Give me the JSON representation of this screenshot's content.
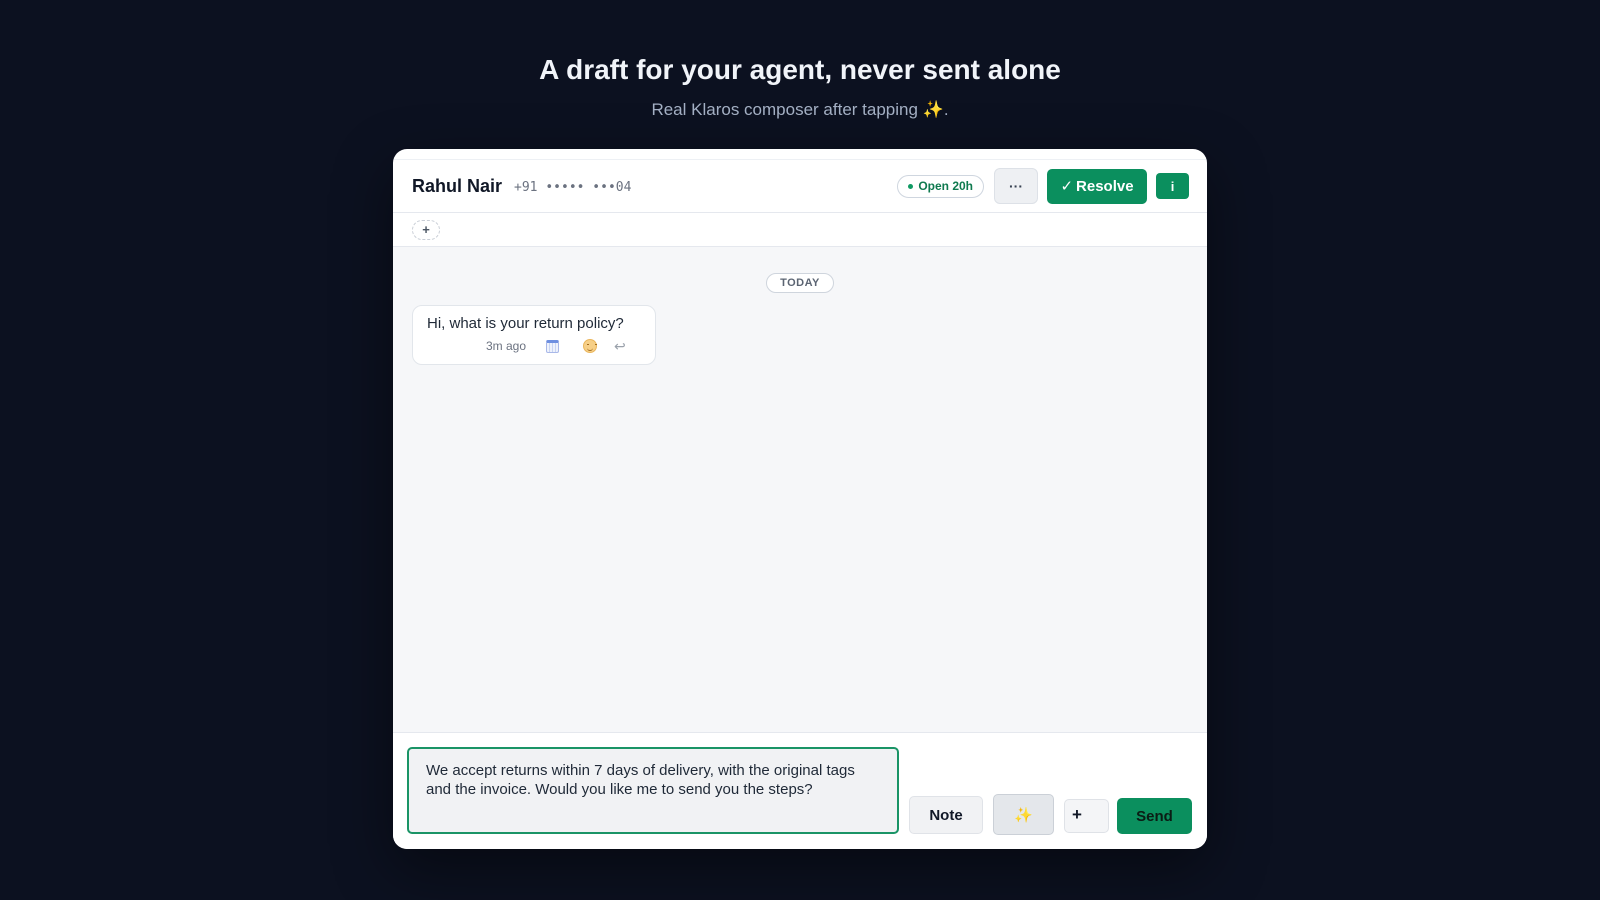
{
  "page": {
    "heading": "A draft for your agent, never sent alone",
    "subtitle": "Real Klaros composer after tapping ✨."
  },
  "header": {
    "contact_name": "Rahul Nair",
    "contact_phone": "+91 ••••• •••04",
    "status": "Open 20h",
    "more_label": "···",
    "resolve_label": "Resolve",
    "resolve_check": "✓",
    "info_label": "i"
  },
  "tags": {
    "add_label": "+"
  },
  "messages": {
    "date_divider": "TODAY",
    "items": [
      {
        "text": "Hi, what is your return policy?",
        "time": "3m ago",
        "reply_glyph": "↩"
      }
    ]
  },
  "composer": {
    "draft": "We accept returns within 7 days of delivery, with the original tags and the invoice. Would you like me to send you the steps?",
    "note_label": "Note",
    "sparkle_label": "✨",
    "attach_label": "+",
    "send_label": "Send"
  },
  "colors": {
    "page_background": "#0c1120",
    "accent_green": "#0b8f5e",
    "status_green": "#0f7a4f"
  },
  "icons": [
    "check-icon",
    "calendar-icon",
    "emoji-icon",
    "reply-icon",
    "sparkle-icon",
    "plus-icon"
  ]
}
